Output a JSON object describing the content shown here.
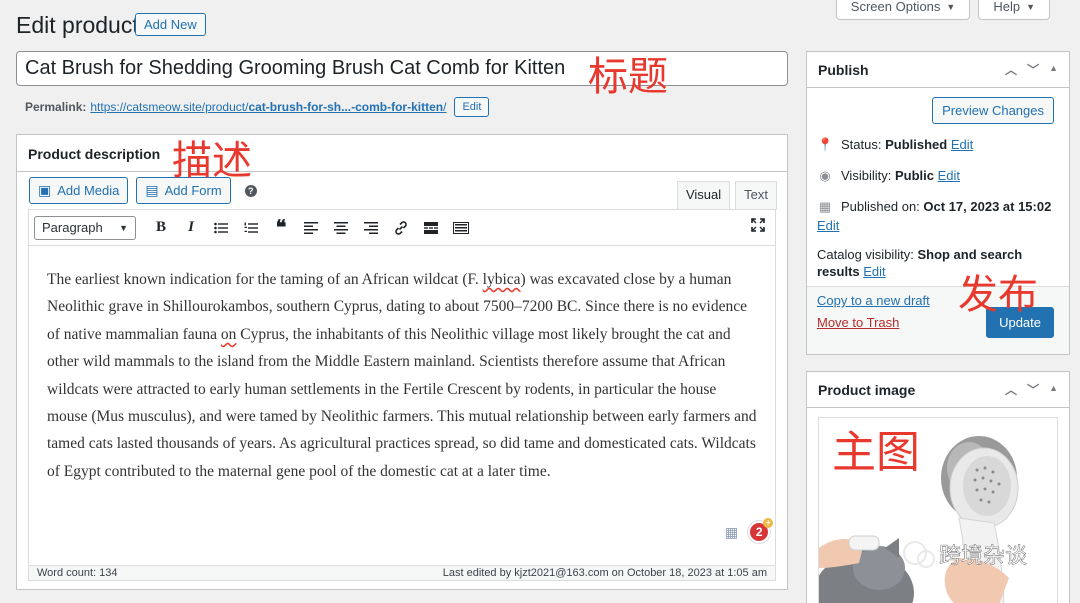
{
  "header": {
    "title": "Edit product",
    "add_new": "Add New",
    "screen_options": "Screen Options",
    "help": "Help"
  },
  "product_title": "Cat Brush for Shedding Grooming Brush Cat Comb for Kitten",
  "annotations": {
    "title": "标题",
    "description": "描述",
    "publish": "发布",
    "main_image": "主图",
    "watermark": "跨境杂谈"
  },
  "permalink": {
    "label": "Permalink:",
    "url_base": "https://catsmeow.site/product/",
    "url_slug": "cat-brush-for-sh...-comb-for-kitten",
    "url_tail": "/",
    "edit": "Edit"
  },
  "description_box": {
    "heading": "Product description",
    "add_media": "Add Media",
    "add_form": "Add Form",
    "tab_visual": "Visual",
    "tab_text": "Text",
    "format": "Paragraph",
    "content_pre": "The earliest known indication for the taming of an African wildcat (F. ",
    "content_lybica": "lybica",
    "content_mid": ") was excavated close by a human Neolithic grave in Shillourokambos, southern Cyprus, dating to about 7500–7200 BC. Since there is no evidence of native mammalian fauna ",
    "content_on": "on",
    "content_post": " Cyprus, the inhabitants of this Neolithic village most likely brought the cat and other wild mammals to the island from the Middle Eastern mainland. Scientists therefore assume that African wildcats were attracted to early human settlements in the Fertile Crescent by rodents, in particular the house mouse (Mus musculus), and were tamed by Neolithic farmers. This mutual relationship between early farmers and tamed cats lasted thousands of years. As agricultural practices spread, so did tame and domesticated cats. Wildcats of Egypt contributed to the maternal gene pool of the domestic cat at a later time.",
    "word_count": "Word count: 134",
    "last_edited": "Last edited by kjzt2021@163.com on October 18, 2023 at 1:05 am",
    "grammar_count": "2"
  },
  "publish": {
    "heading": "Publish",
    "preview": "Preview Changes",
    "status_label": "Status:",
    "status_value": "Published",
    "visibility_label": "Visibility:",
    "visibility_value": "Public",
    "published_label": "Published on:",
    "published_value": "Oct 17, 2023 at 15:02",
    "catalog_label": "Catalog visibility:",
    "catalog_value_1": "Shop and search",
    "catalog_value_2": "results",
    "edit": "Edit",
    "copy_draft": "Copy to a new draft",
    "trash": "Move to Trash",
    "update": "Update"
  },
  "product_image": {
    "heading": "Product image"
  }
}
